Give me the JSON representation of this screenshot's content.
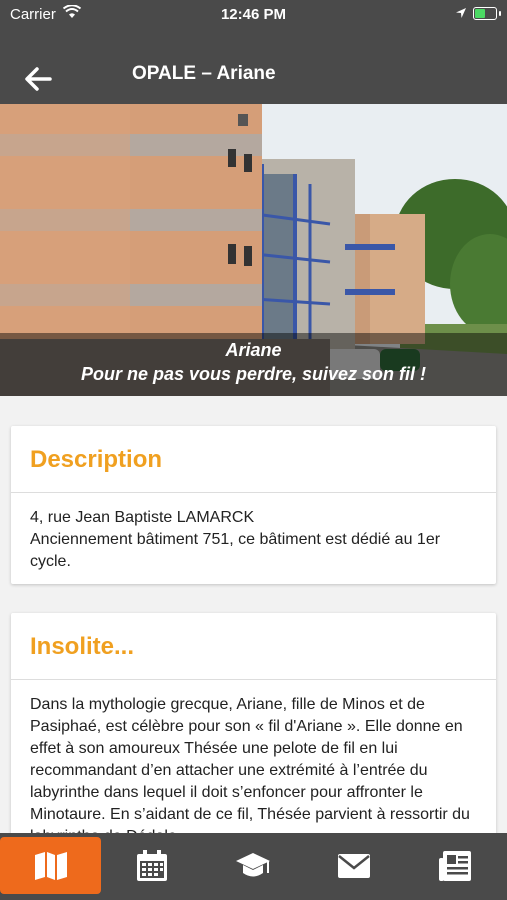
{
  "status_bar": {
    "carrier": "Carrier",
    "time": "12:46 PM"
  },
  "header": {
    "title": "OPALE – Ariane"
  },
  "hero": {
    "caption_line1": "Ariane",
    "caption_line2": "Pour ne pas vous perdre, suivez son fil !"
  },
  "description": {
    "heading": "Description",
    "line1": "4, rue Jean Baptiste LAMARCK",
    "line2": "Anciennement bâtiment 751, ce bâtiment est dédié au 1er cycle."
  },
  "insolite": {
    "heading": "Insolite...",
    "text": "Dans la mythologie grecque, Ariane, fille de Minos et de Pasiphaé, est célèbre pour son « fil d'Ariane ». Elle donne en effet à son amoureux Thésée une pelote de fil en lui recommandant d’en attacher une extrémité à l’entrée du labyrinthe dans lequel il doit s’enfoncer pour affronter le Minotaure. En s’aidant de ce fil, Thésée parvient à ressortir du labyrinthe de Dédale"
  },
  "tabbar": {
    "items": [
      "map-icon",
      "calendar-icon",
      "graduation-cap-icon",
      "mail-icon",
      "news-icon"
    ],
    "active_index": 0
  },
  "colors": {
    "accent": "#f0a020",
    "tab_active": "#ee6a1c",
    "bar": "#4a4a4a"
  }
}
